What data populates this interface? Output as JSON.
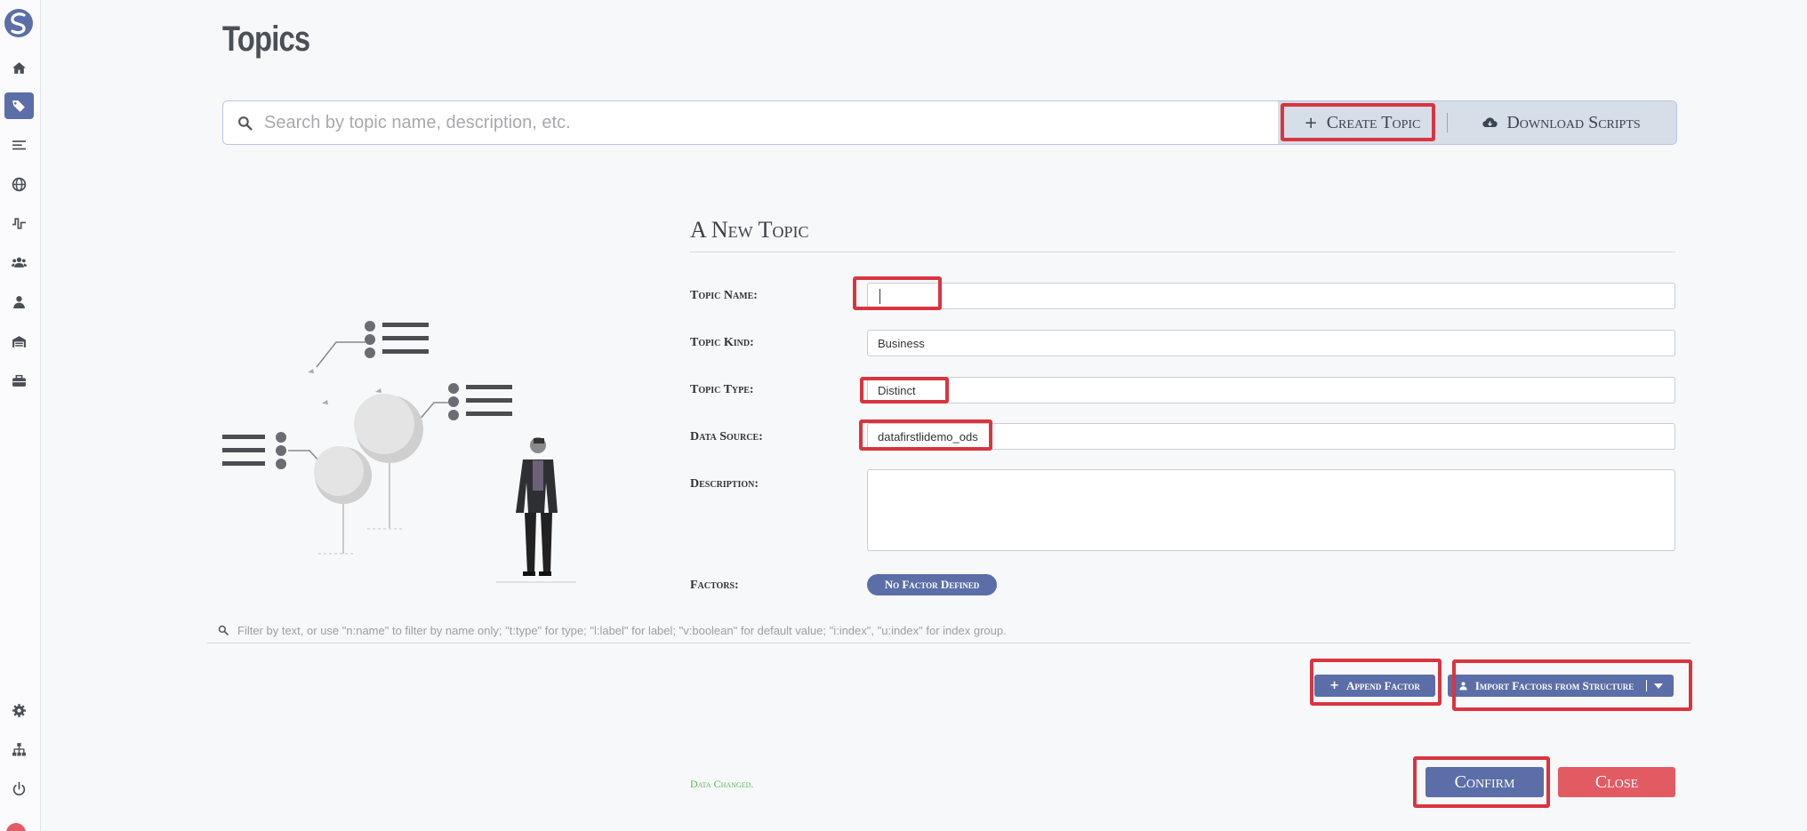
{
  "page": {
    "title": "Topics"
  },
  "search": {
    "placeholder": "Search by topic name, description, etc.",
    "create_label": "Create Topic",
    "download_label": "Download Scripts"
  },
  "sidebar": {
    "items": [
      {
        "icon": "home-icon"
      },
      {
        "icon": "tags-icon",
        "active": true
      },
      {
        "icon": "list-icon"
      },
      {
        "icon": "globe-icon"
      },
      {
        "icon": "pulse-icon"
      },
      {
        "icon": "users-icon"
      },
      {
        "icon": "user-icon"
      },
      {
        "icon": "warehouse-icon"
      },
      {
        "icon": "toolbox-icon"
      },
      {
        "icon": "gear-icon"
      },
      {
        "icon": "sitemap-icon"
      },
      {
        "icon": "power-icon"
      }
    ]
  },
  "form": {
    "title": "A New Topic",
    "labels": {
      "name": "Topic Name:",
      "kind": "Topic Kind:",
      "type": "Topic Type:",
      "source": "Data Source:",
      "description": "Description:",
      "factors": "Factors:"
    },
    "values": {
      "name": "",
      "kind": "Business",
      "type": "Distinct",
      "source": "datafirstlidemo_ods",
      "description": ""
    },
    "no_factor_label": "No Factor Defined"
  },
  "filter": {
    "text": "Filter by text, or use \"n:name\" to filter by name only; \"t:type\" for type; \"l:label\" for label; \"v:boolean\" for default value; \"i:index\", \"u:index\" for index group."
  },
  "actions": {
    "append_factor": "Append Factor",
    "import_factors": "Import Factors from Structure",
    "data_changed": "Data Changed.",
    "confirm": "Confirm",
    "close": "Close"
  },
  "colors": {
    "accent": "#5b6ea8",
    "danger": "#e25b63",
    "success": "#5cb85c",
    "annotation": "#d9353f"
  }
}
